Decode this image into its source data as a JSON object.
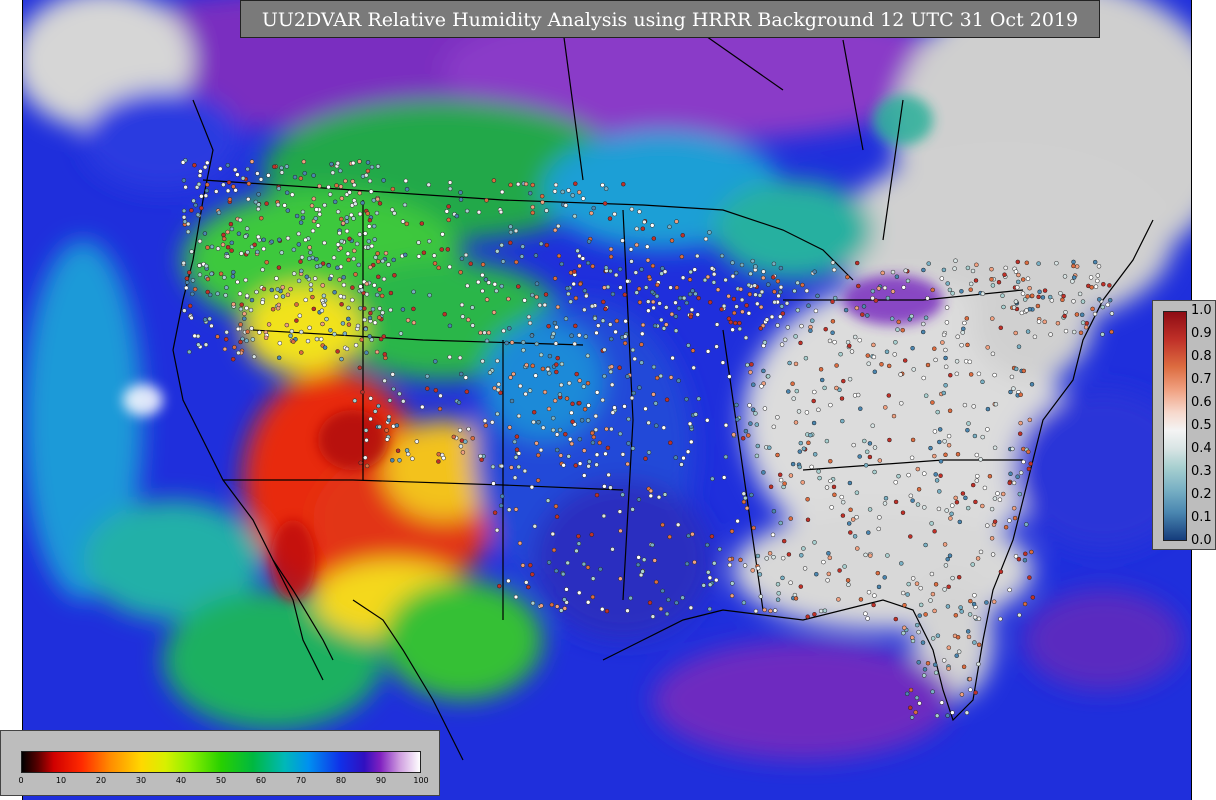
{
  "title": "UU2DVAR Relative Humidity Analysis using HRRR Background 12 UTC 31 Oct 2019",
  "rh_colorbar": {
    "ticks": [
      "0",
      "10",
      "20",
      "30",
      "40",
      "50",
      "60",
      "70",
      "80",
      "90",
      "100"
    ]
  },
  "station_colorbar": {
    "ticks": [
      "1.0",
      "0.9",
      "0.8",
      "0.7",
      "0.6",
      "0.5",
      "0.4",
      "0.3",
      "0.2",
      "0.1",
      "0.0"
    ]
  }
}
